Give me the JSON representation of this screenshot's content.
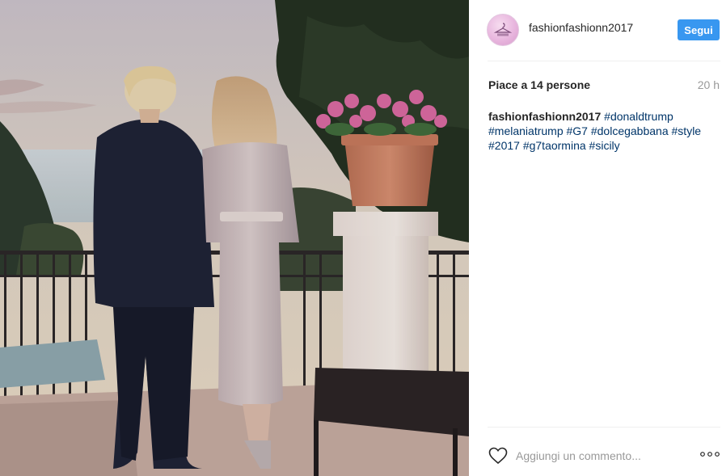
{
  "post": {
    "username": "fashionfashionn2017",
    "follow_label": "Segui",
    "avatar_icon": "hanger-logo-icon",
    "likes_text": "Piace a 14 persone",
    "time_text": "20 h",
    "caption": {
      "user": "fashionfashionn2017",
      "hashtags": [
        "#donaldtrump",
        "#melaniatrump",
        "#G7",
        "#dolcegabbana",
        "#style",
        "#2017",
        "#g7taormina",
        "#sicily"
      ]
    },
    "comment_placeholder": "Aggiungi un commento...",
    "colors": {
      "accent": "#3897f0",
      "hashtag": "#003569",
      "muted": "#999999",
      "text": "#262626"
    }
  },
  "icons": {
    "like": "heart-icon",
    "more": "more-options-icon"
  }
}
